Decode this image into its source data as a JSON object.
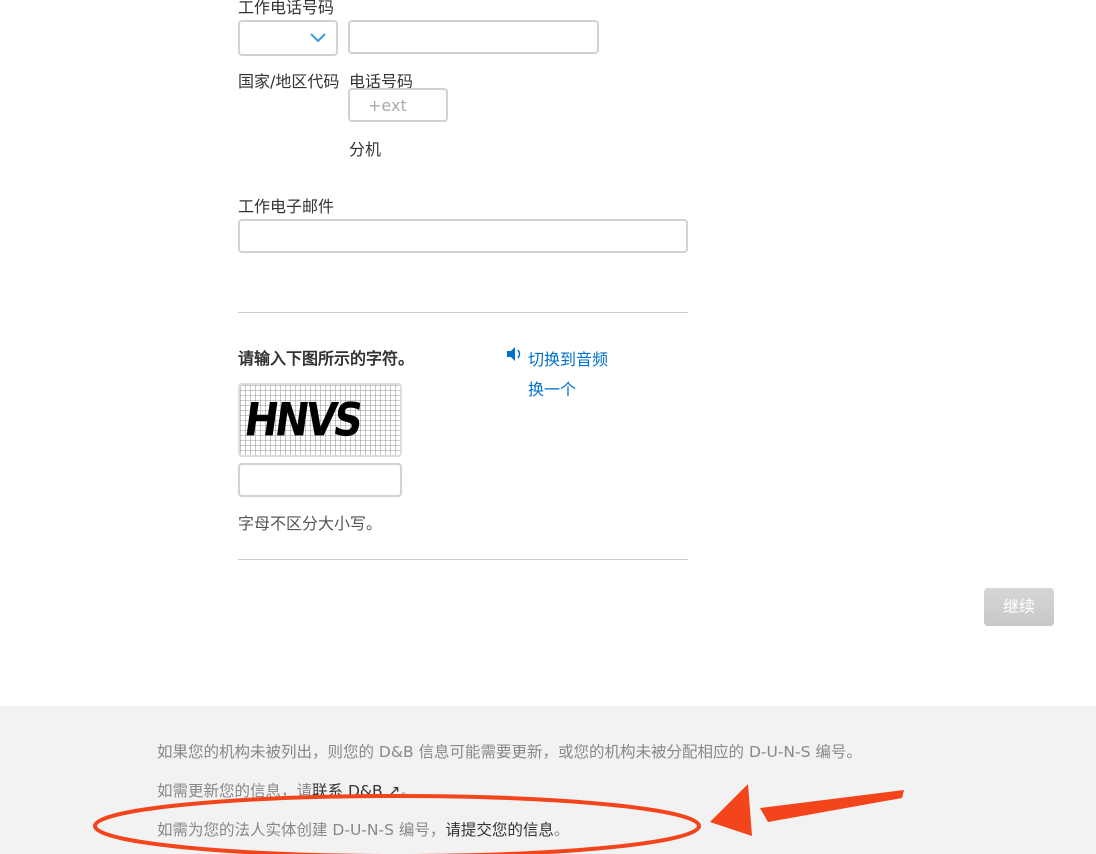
{
  "phone": {
    "label": "工作电话号码",
    "country_label": "国家/地区代码",
    "number_label": "电话号码",
    "ext_placeholder": "+ext",
    "ext_label": "分机"
  },
  "email": {
    "label": "工作电子邮件"
  },
  "captcha": {
    "prompt": "请输入下图所示的字符。",
    "audio_link": "切换到音频",
    "refresh_link": "换一个",
    "image_text": "HNVS",
    "hint": "字母不区分大小写。"
  },
  "continue_label": "继续",
  "footer": {
    "line1": "如果您的机构未被列出，则您的 D&B 信息可能需要更新，或您的机构未被分配相应的 D-U-N-S 编号。",
    "line2_prefix": "如需更新您的信息，请",
    "line2_link": "联系 D&B ↗",
    "line2_suffix": "。",
    "line3_prefix": "如需为您的法人实体创建 D-U-N-S 编号，",
    "line3_link": "请提交您的信息",
    "line3_suffix": "。"
  },
  "colors": {
    "link": "#0070c9",
    "annotation": "#f4441c",
    "footer_bg": "#f2f2f2"
  }
}
